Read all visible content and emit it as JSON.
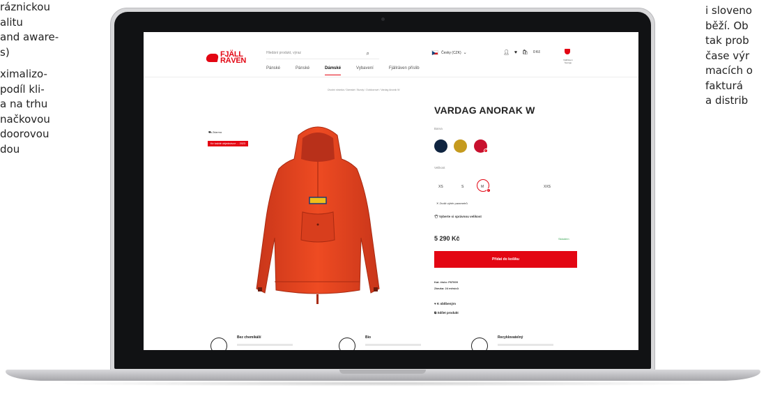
{
  "left_text": [
    "ráznickou",
    "alitu",
    "and aware-",
    "s)",
    "ximalizo-",
    "podíl kli-",
    "a na trhu",
    "načkovou",
    "doorovou",
    "dou"
  ],
  "right_text": [
    "i sloveno",
    "běží. Ob",
    "tak prob",
    "čase výr",
    "macích o",
    "fakturá",
    "a distrib"
  ],
  "site": {
    "logo_line1": "FJÄLL",
    "logo_line2": "RÄVEN",
    "search_placeholder": "Hledání produkt, výraz",
    "language": "Česky (CZK)",
    "cart_total": "0 Kč",
    "badge_label": "Fjällräven Sverige",
    "nav": [
      "Pánské",
      "Pánské",
      "Dámské",
      "Vybavení",
      "Fjällräven příslib"
    ],
    "breadcrumb": "Úvodní stránka / Dámské / Bundy / Outdoorové / Vardag Anorak W"
  },
  "product": {
    "title": "VARDAG ANORAK W",
    "color_label": "Barva",
    "colors": [
      "#0f2440",
      "#c59a1e",
      "#c8102e"
    ],
    "size_label": "Velikost",
    "sizes": [
      "XS",
      "S",
      "M",
      "XXS"
    ],
    "reset_label": "Zrušit výběr parametrů",
    "size_guide": "Vyberte si správnou velikost",
    "price": "5 290 Kč",
    "stock": "Skladem",
    "add_to_cart": "Přidat do košíku",
    "catalog_no": "Kat. číslo: F87009",
    "warranty": "Záruka: 24 měsíců",
    "favorite": "K oblíbeným",
    "share": "Sdílet produkt",
    "tag_delivery": "Zdarma",
    "tag_gift": "Ke každé objednávce ... 2023",
    "accent": "#e30613"
  },
  "features": [
    "Bez chemikálií",
    "Bio",
    "Recyklovatelný"
  ]
}
